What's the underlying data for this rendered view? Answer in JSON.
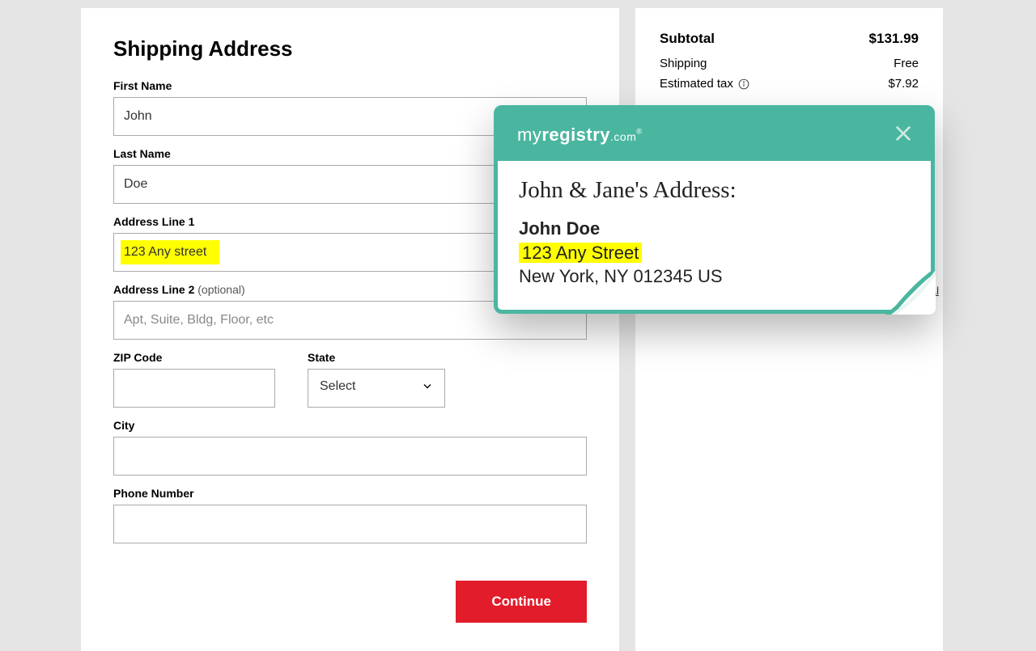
{
  "heading": "Shipping Address",
  "fields": {
    "first_name": {
      "label": "First Name",
      "value": "John"
    },
    "last_name": {
      "label": "Last Name",
      "value": "Doe"
    },
    "address1": {
      "label": "Address Line 1",
      "value": "123 Any street"
    },
    "address2": {
      "label": "Address Line 2",
      "optional": "(optional)",
      "placeholder": "Apt, Suite, Bldg, Floor, etc"
    },
    "zip": {
      "label": "ZIP Code",
      "value": ""
    },
    "state": {
      "label": "State",
      "value": "Select"
    },
    "city": {
      "label": "City",
      "value": ""
    },
    "phone": {
      "label": "Phone Number",
      "value": ""
    }
  },
  "continue_label": "Continue",
  "summary": {
    "subtotal_label": "Subtotal",
    "subtotal_value": "$131.99",
    "shipping_label": "Shipping",
    "shipping_value": "Free",
    "tax_label": "Estimated tax",
    "tax_value": "$7.92"
  },
  "legal_link": "egal",
  "popup": {
    "logo_my": "my",
    "logo_registry": "registry",
    "logo_com": ".com",
    "title": "John & Jane's Address:",
    "name": "John Doe",
    "street": "123 Any Street",
    "citystate": "New York, NY 012345 US"
  }
}
